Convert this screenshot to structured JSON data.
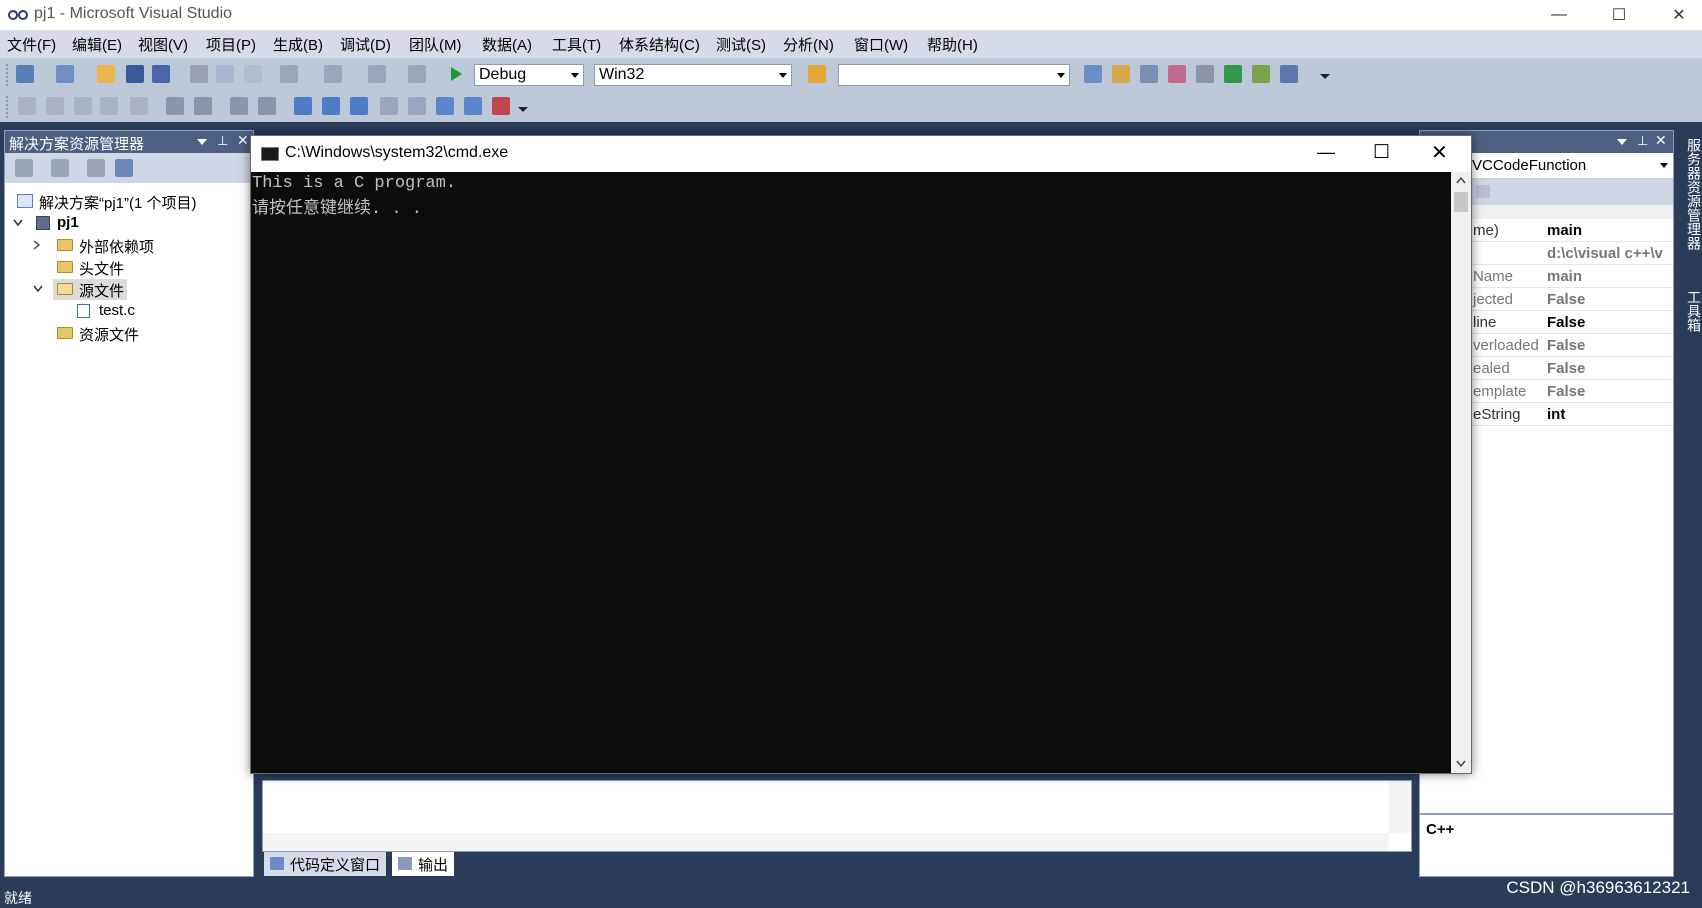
{
  "window": {
    "title": "pj1 - Microsoft Visual Studio",
    "controls": [
      "—",
      "☐",
      "✕"
    ]
  },
  "menu": [
    "文件(F)",
    "编辑(E)",
    "视图(V)",
    "项目(P)",
    "生成(B)",
    "调试(D)",
    "团队(M)",
    "数据(A)",
    "工具(T)",
    "体系结构(C)",
    "测试(S)",
    "分析(N)",
    "窗口(W)",
    "帮助(H)"
  ],
  "toolbar": {
    "config": "Debug",
    "platform": "Win32",
    "find_value": ""
  },
  "solution_explorer": {
    "title": "解决方案资源管理器",
    "solution": "解决方案“pj1”(1 个项目)",
    "project": "pj1",
    "items": [
      "外部依赖项",
      "头文件",
      "源文件",
      "test.c",
      "资源文件"
    ]
  },
  "console": {
    "title": "C:\\Windows\\system32\\cmd.exe",
    "lines": [
      "This is a C program.",
      "请按任意键继续. . ."
    ]
  },
  "properties": {
    "object": "VCCodeFunction",
    "rows": [
      {
        "name": "me)",
        "value": "main",
        "gray": false
      },
      {
        "name": "",
        "value": "d:\\c\\visual c++\\v",
        "gray": true
      },
      {
        "name": "Name",
        "value": "main",
        "gray": true
      },
      {
        "name": "jected",
        "value": "False",
        "gray": true
      },
      {
        "name": "line",
        "value": "False",
        "gray": false
      },
      {
        "name": "verloaded",
        "value": "False",
        "gray": true
      },
      {
        "name": "ealed",
        "value": "False",
        "gray": true
      },
      {
        "name": "emplate",
        "value": "False",
        "gray": true
      },
      {
        "name": "eString",
        "value": "int",
        "gray": false
      }
    ],
    "language": "C++"
  },
  "right_strip": [
    "服务器资源管理器",
    "工具箱"
  ],
  "bottom_tabs": [
    "代码定义窗口",
    "输出"
  ],
  "status": "就绪",
  "watermark": "CSDN @h36963612321"
}
